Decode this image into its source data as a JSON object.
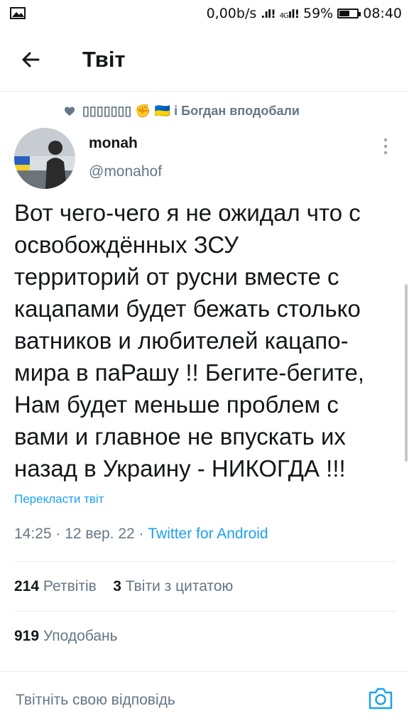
{
  "status_bar": {
    "speed": "0,00b/s",
    "network": "4G",
    "battery": "59%",
    "battery_level": 0.59,
    "time": "08:40"
  },
  "header": {
    "title": "Твіт"
  },
  "social_context": {
    "liked_text": "▯▯▯▯▯▯▯ ✊ 🇺🇦 і Богдан вподобали"
  },
  "tweet": {
    "author_name": "monah",
    "author_handle": "@monahof",
    "text": "Вот чего-чего я не ожидал что с\nосвобождённых ЗСУ\nтерриторий от русни вместе с\nкацапами будет бежать столько\nватников и любителей кацапо-\nмира в паРашу !! Бегите-бегите,\nНам будет меньше проблем с\nвами и главное не впускать их\nназад в Украину - НИКОГДА !!!",
    "translate_label": "Перекласти твіт",
    "timestamp": "14:25 · 12 вер. 22 · ",
    "source": "Twitter for Android"
  },
  "stats": {
    "retweets_count": "214",
    "retweets_label": "Ретвітів",
    "quotes_count": "3",
    "quotes_label": "Твіти з цитатою",
    "likes_count": "919",
    "likes_label": "Уподобань"
  },
  "reply": {
    "placeholder": "Твітніть свою відповідь"
  },
  "colors": {
    "accent": "#1da1f2",
    "muted": "#657786",
    "text": "#14171a",
    "divider": "#e6ecf0"
  }
}
